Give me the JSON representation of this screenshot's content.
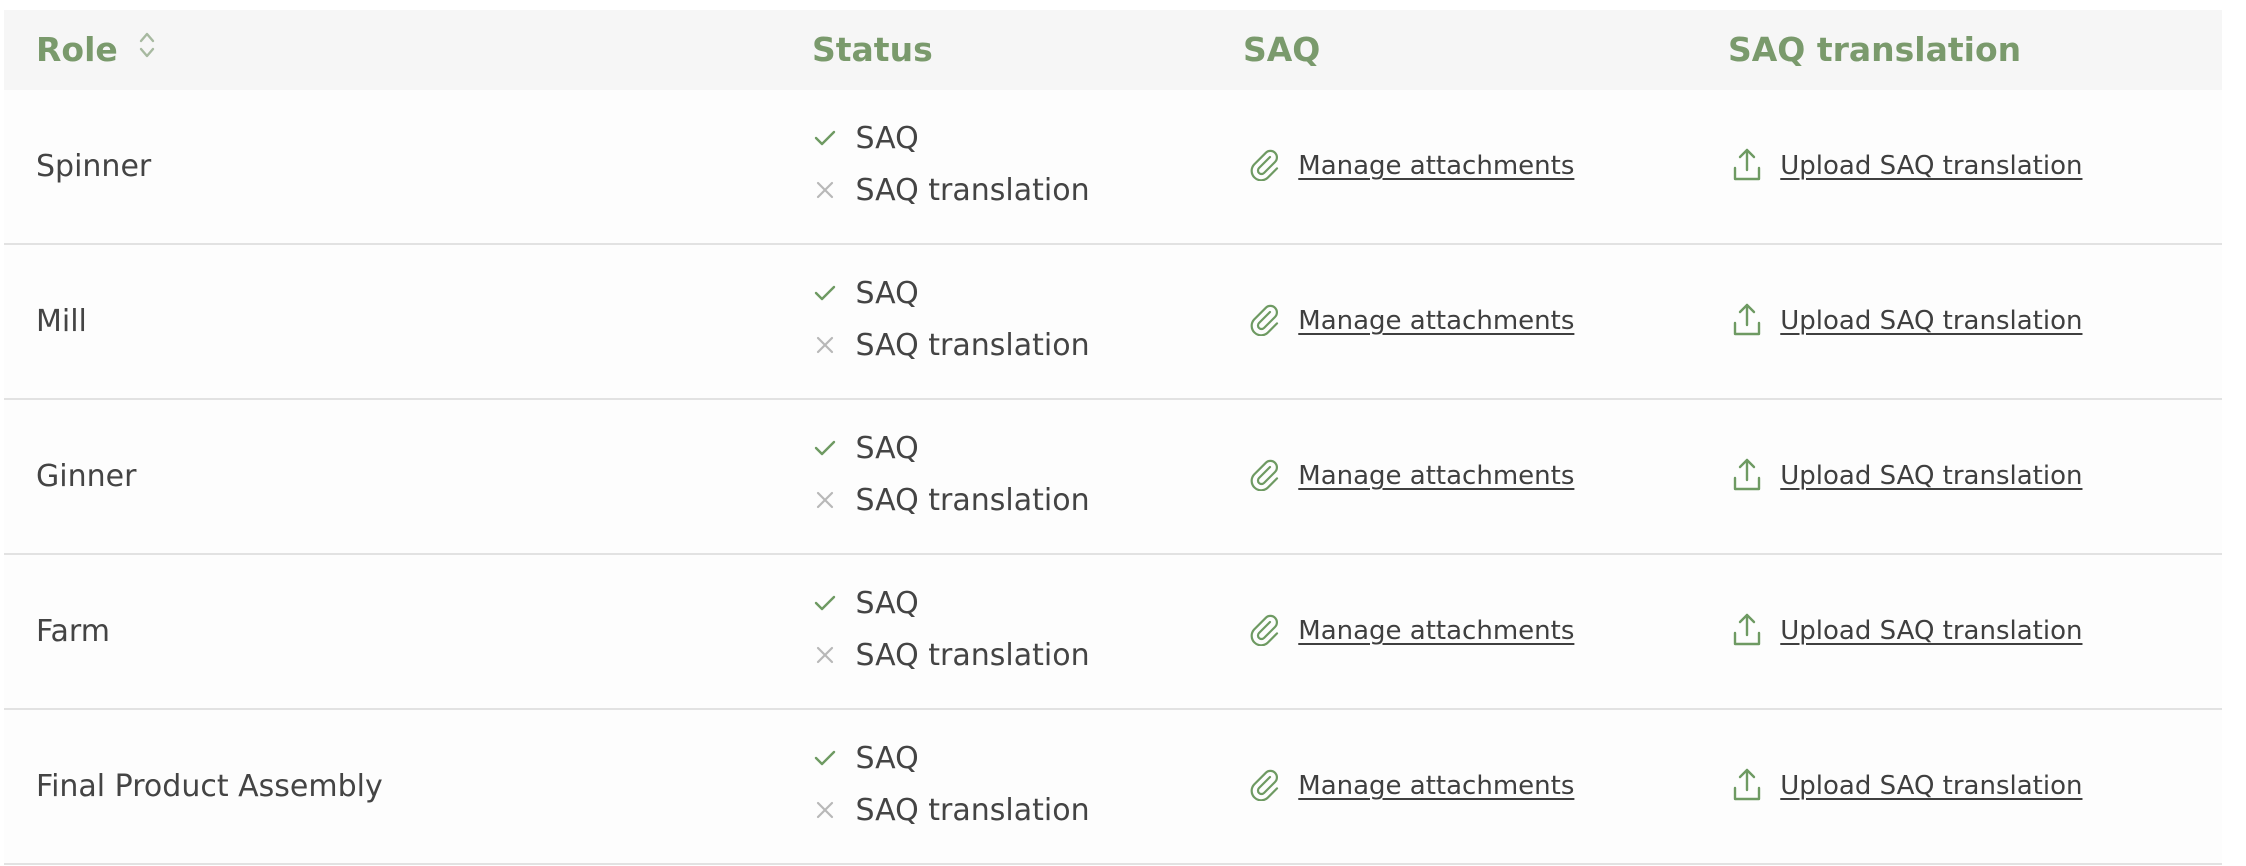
{
  "table": {
    "headers": {
      "role": "Role",
      "status": "Status",
      "saq": "SAQ",
      "saq_translation": "SAQ translation"
    },
    "rows": [
      {
        "role": "Spinner",
        "status": [
          {
            "label": "SAQ",
            "state": "complete"
          },
          {
            "label": "SAQ translation",
            "state": "missing"
          }
        ],
        "saq_action": "Manage attachments",
        "translation_action": "Upload SAQ translation"
      },
      {
        "role": "Mill",
        "status": [
          {
            "label": "SAQ",
            "state": "complete"
          },
          {
            "label": "SAQ translation",
            "state": "missing"
          }
        ],
        "saq_action": "Manage attachments",
        "translation_action": "Upload SAQ translation"
      },
      {
        "role": "Ginner",
        "status": [
          {
            "label": "SAQ",
            "state": "complete"
          },
          {
            "label": "SAQ translation",
            "state": "missing"
          }
        ],
        "saq_action": "Manage attachments",
        "translation_action": "Upload SAQ translation"
      },
      {
        "role": "Farm",
        "status": [
          {
            "label": "SAQ",
            "state": "complete"
          },
          {
            "label": "SAQ translation",
            "state": "missing"
          }
        ],
        "saq_action": "Manage attachments",
        "translation_action": "Upload SAQ translation"
      },
      {
        "role": "Final Product Assembly",
        "status": [
          {
            "label": "SAQ",
            "state": "complete"
          },
          {
            "label": "SAQ translation",
            "state": "missing"
          }
        ],
        "saq_action": "Manage attachments",
        "translation_action": "Upload SAQ translation"
      }
    ]
  },
  "icons": {
    "sort": "sort-icon",
    "complete": "check-icon",
    "missing": "x-icon",
    "attachment": "paperclip-icon",
    "upload": "upload-icon"
  },
  "colors": {
    "accent": "#7a9a6c",
    "header_bg": "#f6f6f6",
    "check": "#6e9a62",
    "cross": "#b8b8b8",
    "divider": "#e2e2e2"
  }
}
